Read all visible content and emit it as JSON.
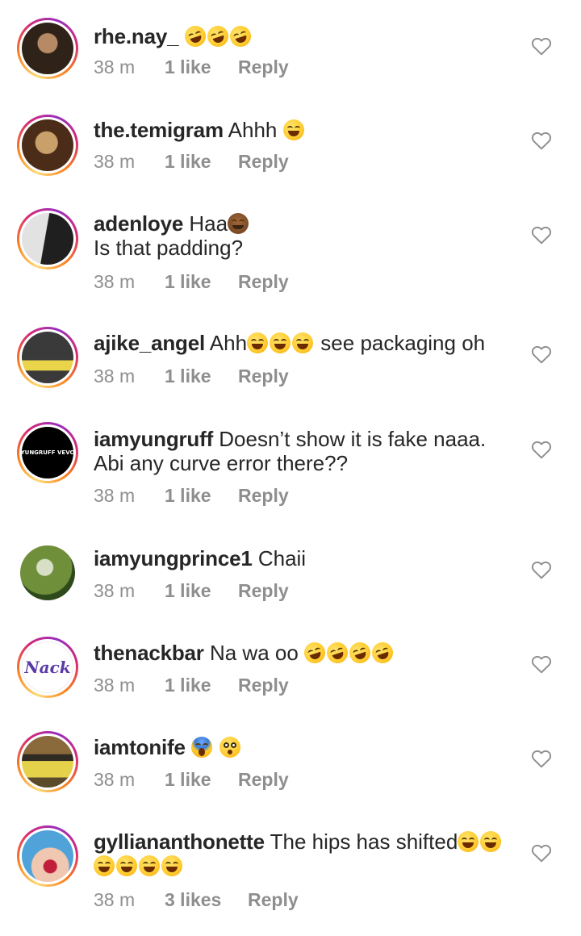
{
  "comments": [
    {
      "username": "rhe.nay_",
      "text": "",
      "emoji": [
        "rolling-on-floor-laughing",
        "rolling-on-floor-laughing",
        "rolling-on-floor-laughing"
      ],
      "time": "38 m",
      "likes": "1 like",
      "reply": "Reply",
      "avatar_colors": [
        "#b58a64",
        "#2f2219"
      ]
    },
    {
      "username": "the.temigram",
      "text": "Ahhh",
      "emoji": [
        "grinning-squinting-face"
      ],
      "time": "38 m",
      "likes": "1 like",
      "reply": "Reply",
      "avatar_colors": [
        "#c9a06a",
        "#4a2c18"
      ]
    },
    {
      "username": "adenloye",
      "text": "Haa",
      "emoji": [
        "person-facepalming"
      ],
      "text_line2": "Is that padding?",
      "time": "38 m",
      "likes": "1 like",
      "reply": "Reply",
      "avatar_colors": [
        "#dcdcdc",
        "#222222"
      ]
    },
    {
      "username": "ajike_angel",
      "text": "Ahh",
      "emoji": [
        "grinning-squinting-face",
        "grinning-squinting-face",
        "grinning-squinting-face"
      ],
      "text_after": "see packaging oh",
      "time": "38 m",
      "likes": "1 like",
      "reply": "Reply",
      "avatar_colors": [
        "#3a3a3a",
        "#e9d44a"
      ]
    },
    {
      "username": "iamyungruff",
      "text": "Doesn’t show it is fake naaa.",
      "text_line2": "Abi any curve error there??",
      "time": "38 m",
      "likes": "1 like",
      "reply": "Reply",
      "avatar_label": "YUNGRUFF VEVO",
      "avatar_colors": [
        "#000000",
        "#ffffff"
      ]
    },
    {
      "username": "iamyungprince1",
      "text": "Chaii",
      "time": "38 m",
      "likes": "1 like",
      "reply": "Reply",
      "avatar_colors": [
        "#6f8f3a",
        "#2e4a1c"
      ]
    },
    {
      "username": "thenackbar",
      "text": "Na wa oo",
      "emoji": [
        "rolling-on-floor-laughing",
        "rolling-on-floor-laughing",
        "rolling-on-floor-laughing",
        "rolling-on-floor-laughing"
      ],
      "time": "38 m",
      "likes": "1 like",
      "reply": "Reply",
      "avatar_label": "Nack",
      "avatar_colors": [
        "#ffffff",
        "#5a3aa8"
      ]
    },
    {
      "username": "iamtonife",
      "text": "",
      "emoji": [
        "face-screaming-in-fear",
        "flushed-face"
      ],
      "time": "38 m",
      "likes": "1 like",
      "reply": "Reply",
      "avatar_colors": [
        "#8a6a3a",
        "#e6d24a"
      ]
    },
    {
      "username": "gylliananthonette",
      "text": "The hips has shifted",
      "emoji": [
        "grinning-squinting-face",
        "grinning-squinting-face"
      ],
      "emoji_line2": [
        "grinning-squinting-face",
        "grinning-squinting-face",
        "grinning-squinting-face",
        "grinning-squinting-face"
      ],
      "time": "38 m",
      "likes": "3 likes",
      "reply": "Reply",
      "avatar_colors": [
        "#4fa3d9",
        "#c21d3a"
      ]
    }
  ],
  "icons": {
    "like": "heart-outline-icon"
  }
}
